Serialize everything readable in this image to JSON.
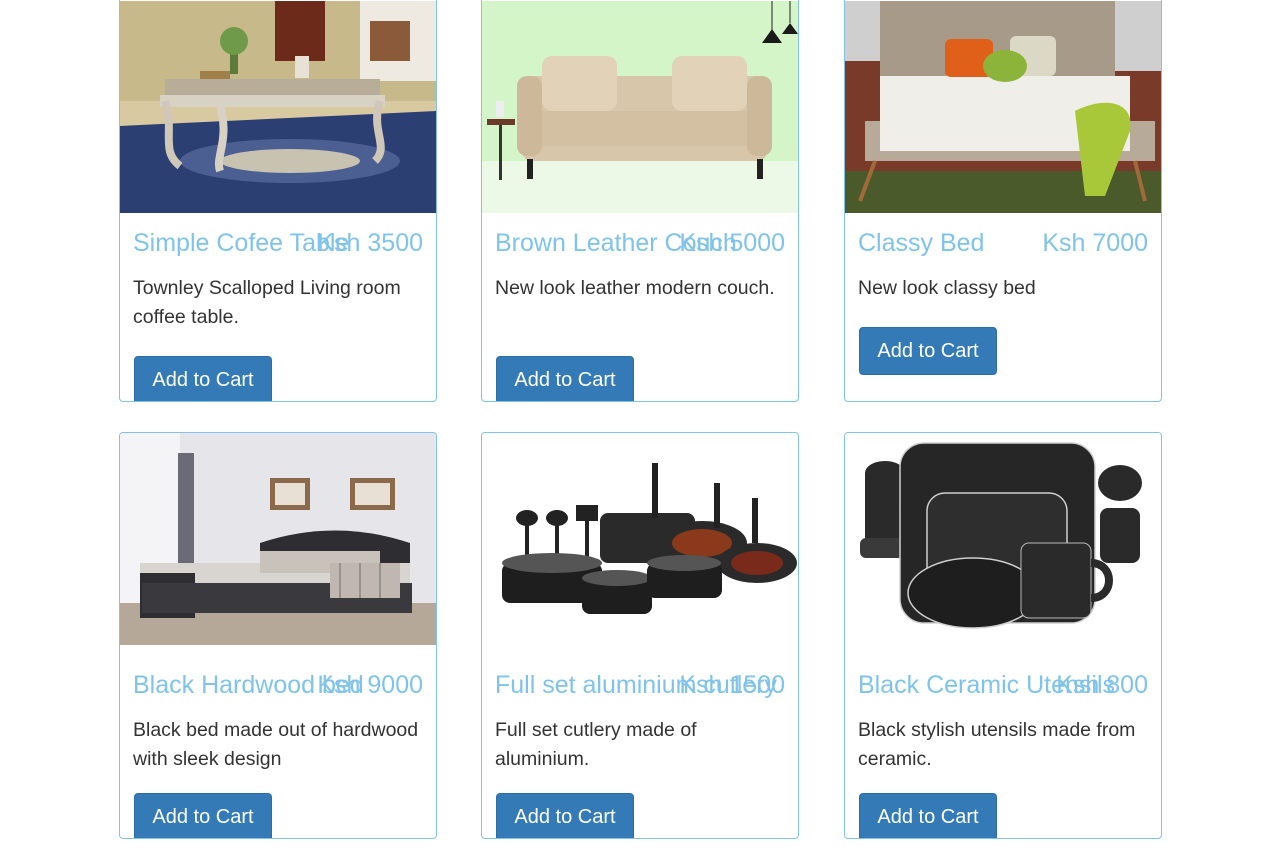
{
  "products": [
    {
      "title": "Simple Cofee Table",
      "price": "Ksh 3500",
      "description": "Townley Scalloped Living room coffee table.",
      "button": "Add to Cart"
    },
    {
      "title": "Brown Leather Couch",
      "price": "Ksh 5000",
      "description": "New look leather modern couch.",
      "button": "Add to Cart"
    },
    {
      "title": "Classy Bed",
      "price": "Ksh 7000",
      "description": "New look classy bed",
      "button": "Add to Cart"
    },
    {
      "title": "Black Hardwood bed",
      "price": "Ksh 9000",
      "description": "Black bed made out of hardwood with sleek design",
      "button": "Add to Cart"
    },
    {
      "title": "Full set aluminium cutlery",
      "price": "Ksh 1500",
      "description": "Full set cutlery made of aluminium.",
      "button": "Add to Cart"
    },
    {
      "title": "Black Ceramic Utensils",
      "price": "Ksh 800",
      "description": "Black stylish utensils made from ceramic.",
      "button": "Add to Cart"
    }
  ],
  "colors": {
    "accent": "#7fc3ec",
    "button": "#337ab7",
    "text": "#333333"
  }
}
